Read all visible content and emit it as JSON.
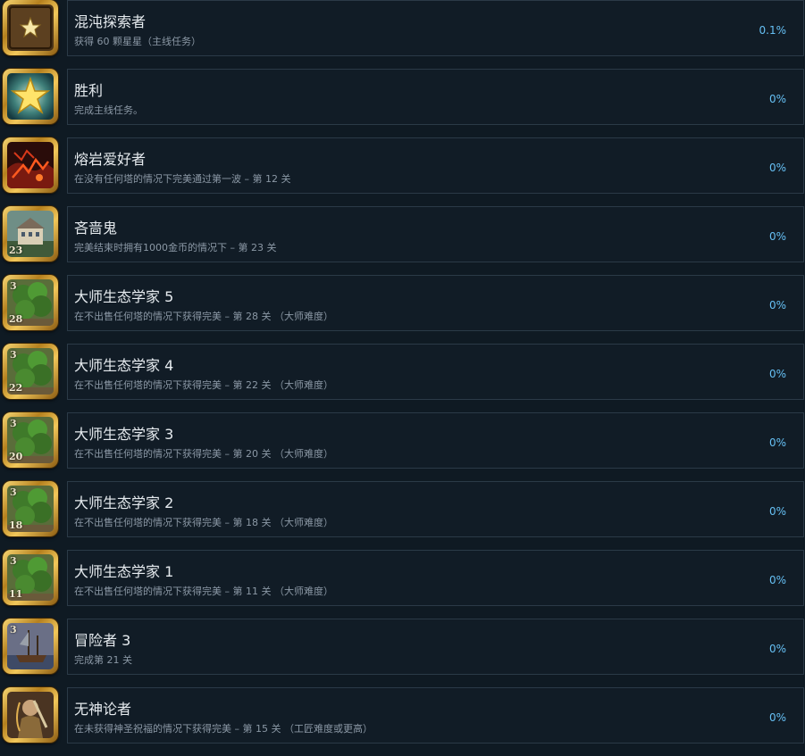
{
  "achievements": [
    {
      "title": "混沌探索者",
      "desc": "获得 60 颗星星（主线任务）",
      "percent": "0.1%",
      "icon": "star-badge-icon"
    },
    {
      "title": "胜利",
      "desc": "完成主线任务。",
      "percent": "0%",
      "icon": "glowing-star-icon"
    },
    {
      "title": "熔岩爱好者",
      "desc": "在没有任何塔的情况下完美通过第一波 – 第 12 关",
      "percent": "0%",
      "icon": "lava-icon"
    },
    {
      "title": "吝啬鬼",
      "desc": "完美结束时拥有1000金币的情况下 – 第 23 关",
      "percent": "0%",
      "icon": "mansion-icon"
    },
    {
      "title": "大师生态学家 5",
      "desc": "在不出售任何塔的情况下获得完美 – 第 28 关 （大师难度）",
      "percent": "0%",
      "icon": "tree-level-icon"
    },
    {
      "title": "大师生态学家 4",
      "desc": "在不出售任何塔的情况下获得完美 – 第 22 关 （大师难度）",
      "percent": "0%",
      "icon": "tree-level-icon"
    },
    {
      "title": "大师生态学家 3",
      "desc": "在不出售任何塔的情况下获得完美 – 第 20 关 （大师难度）",
      "percent": "0%",
      "icon": "tree-level-icon"
    },
    {
      "title": "大师生态学家 2",
      "desc": "在不出售任何塔的情况下获得完美 – 第 18 关 （大师难度）",
      "percent": "0%",
      "icon": "tree-level-icon"
    },
    {
      "title": "大师生态学家 1",
      "desc": "在不出售任何塔的情况下获得完美 – 第 11 关 （大师难度）",
      "percent": "0%",
      "icon": "tree-level-icon"
    },
    {
      "title": "冒险者 3",
      "desc": "完成第 21 关",
      "percent": "0%",
      "icon": "ship-icon"
    },
    {
      "title": "无神论者",
      "desc": "在未获得神圣祝福的情况下获得完美 – 第 15 关 （工匠难度或更高）",
      "percent": "0%",
      "icon": "hero-icon"
    }
  ],
  "icon_badges": {
    "tree_numbers": [
      "28",
      "22",
      "20",
      "18",
      "11"
    ],
    "tree_tier": "3",
    "ship_tier": "3",
    "mansion_number": "23"
  },
  "colors": {
    "background": "#0f1a23",
    "panel": "#111c26",
    "border": "#2b3a47",
    "title": "#e6ebef",
    "desc": "#8b98a5",
    "percent": "#66c0f4",
    "gold": "#d9a733"
  }
}
